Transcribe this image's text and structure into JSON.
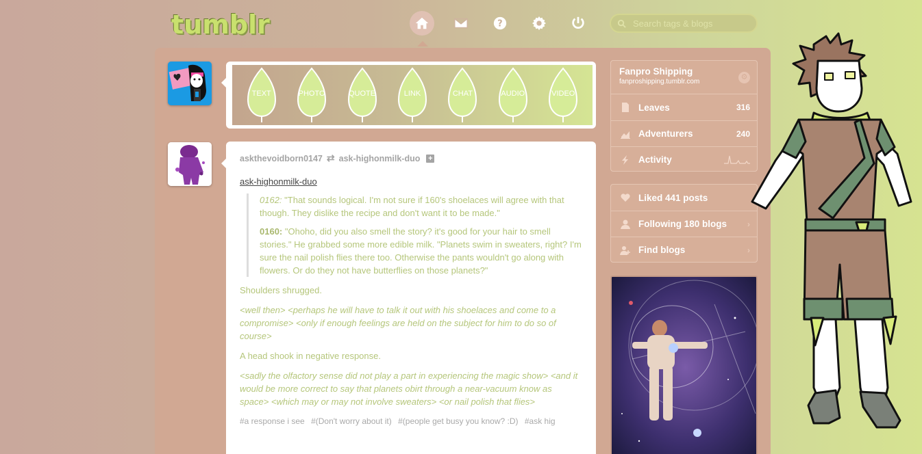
{
  "header": {
    "logo": "tumblr",
    "nav": [
      {
        "name": "dashboard",
        "icon": "home-icon"
      },
      {
        "name": "inbox",
        "icon": "mail-icon"
      },
      {
        "name": "help",
        "icon": "help-icon"
      },
      {
        "name": "settings",
        "icon": "gear-icon"
      },
      {
        "name": "logout",
        "icon": "power-icon"
      }
    ],
    "search_placeholder": "Search tags & blogs"
  },
  "post_types": [
    "TEXT",
    "PHOTO",
    "QUOTE",
    "LINK",
    "CHAT",
    "AUDIO",
    "VIDEO"
  ],
  "post": {
    "author": "askthevoidborn0147",
    "reblogged_from": "ask-highonmilk-duo",
    "source_link": "ask-highonmilk-duo",
    "quote": {
      "p1_speaker": "0162:",
      "p1_text": " \"That sounds logical. I'm not sure if 160's shoelaces will agree with that though. They dislike the recipe and don't want it to be made.\"",
      "p2_speaker": "0160:",
      "p2_text": " \"Ohoho, did you also smell the story? it's good for your hair to smell stories.\" He grabbed some more edible milk. \"Planets swim in sweaters, right? I'm sure the nail polish flies there too. Otherwise the pants wouldn't go along with flowers. Or do they not have butterflies on those planets?\""
    },
    "body": [
      "Shoulders shrugged.",
      "<well then> <perhaps he will have to talk it out with his shoelaces and come to a compromise> <only if enough feelings are held on the subject for him to do so of course>",
      "A head shook in negative response.",
      "<sadly the olfactory sense did not play a part in experiencing the magic show> <and it would be more correct to say that planets obirt through a near-vacuum know as space> <which may or may not involve sweaters> <or nail polish that flies>"
    ],
    "tags": [
      "#a response i see",
      "#(Don't worry about it)",
      "#(people get busy you know? :D)",
      "#ask hig"
    ]
  },
  "sidebar": {
    "blog_title": "Fanpro Shipping",
    "blog_url": "fanproshipping.tumblr.com",
    "rows": [
      {
        "label": "Leaves",
        "count": "316",
        "icon": "page-icon"
      },
      {
        "label": "Adventurers",
        "count": "240",
        "icon": "chart-icon"
      },
      {
        "label": "Activity",
        "icon": "lightning-icon"
      }
    ],
    "links": [
      {
        "label": "Liked 441 posts",
        "icon": "heart-icon"
      },
      {
        "label": "Following 180 blogs",
        "icon": "person-icon"
      },
      {
        "label": "Find blogs",
        "icon": "person-add-icon"
      }
    ]
  },
  "colors": {
    "accent_green": "#b5c67b",
    "panel": "#d1a893",
    "text_gray": "#a4a4a4"
  }
}
